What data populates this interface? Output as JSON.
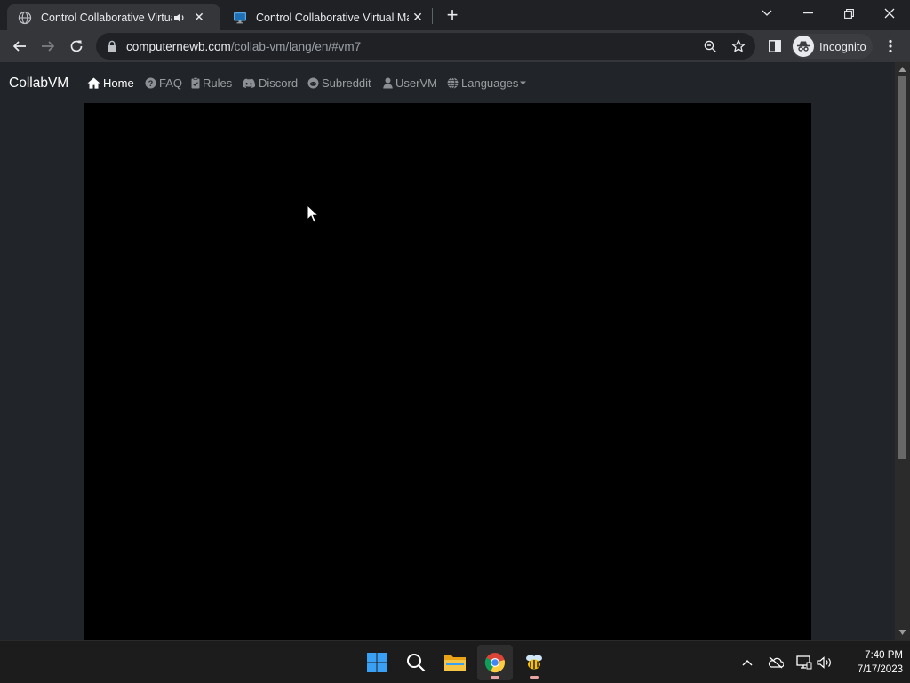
{
  "browser": {
    "tabs": [
      {
        "title": "Control Collaborative Virtual Machines!",
        "active": true,
        "favicon": "globe-icon",
        "audio": true
      },
      {
        "title": "Control Collaborative Virtual Machines!",
        "active": false,
        "favicon": "monitor-icon",
        "audio": false
      }
    ],
    "url_host": "computernewb.com",
    "url_path": "/collab-vm/lang/en/#vm7",
    "incognito_label": "Incognito",
    "theme": {
      "tabstrip": "#202124",
      "toolbar": "#35363a",
      "omnibox": "#202124"
    }
  },
  "page": {
    "brand": "CollabVM",
    "nav": [
      {
        "label": "Home",
        "icon": "home-icon",
        "active": true
      },
      {
        "label": "FAQ",
        "icon": "question-icon",
        "active": false
      },
      {
        "label": "Rules",
        "icon": "clipboard-icon",
        "active": false
      },
      {
        "label": "Discord",
        "icon": "discord-icon",
        "active": false
      },
      {
        "label": "Subreddit",
        "icon": "reddit-icon",
        "active": false
      },
      {
        "label": "UserVM",
        "icon": "user-icon",
        "active": false
      },
      {
        "label": "Languages",
        "icon": "globe-icon",
        "active": false,
        "dropdown": true
      }
    ],
    "background": "#212529",
    "vm_screen_color": "#000000"
  },
  "taskbar": {
    "apps": [
      "windows-start-icon",
      "search-icon",
      "file-explorer-icon",
      "chrome-icon",
      "bee-app-icon"
    ],
    "tray": [
      "chevron-up-icon",
      "onedrive-offline-icon",
      "network-icon",
      "volume-icon"
    ],
    "time": "7:40 PM",
    "date": "7/17/2023"
  }
}
